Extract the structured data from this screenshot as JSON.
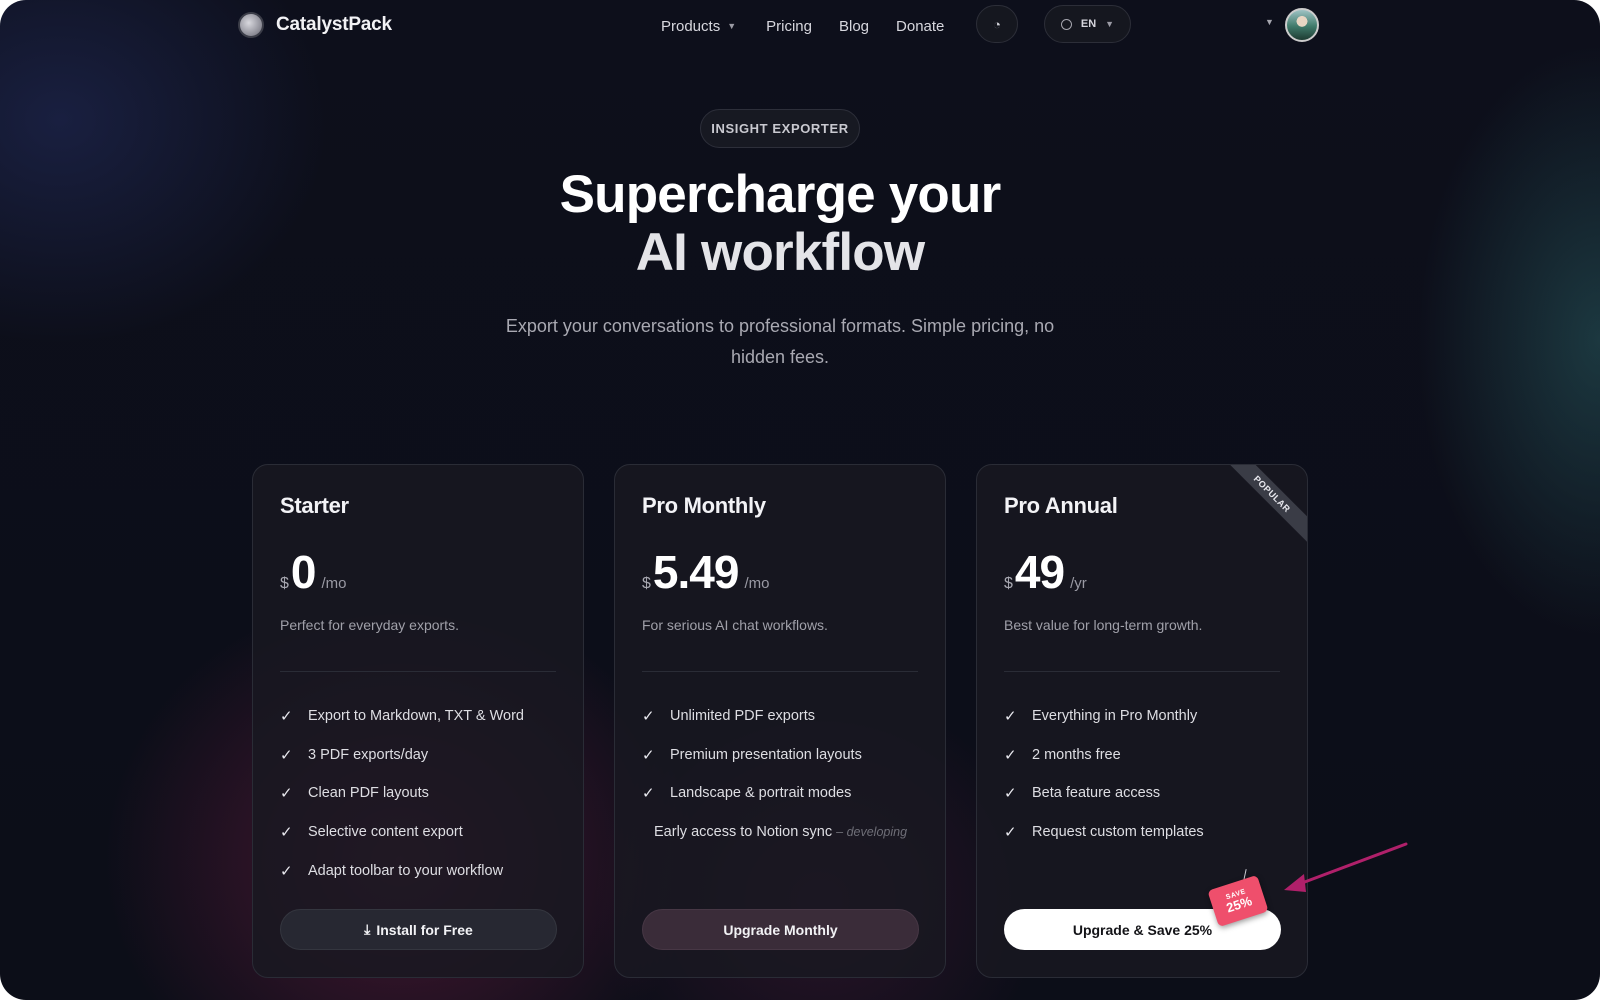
{
  "brand": {
    "name": "CatalystPack"
  },
  "nav": {
    "items": [
      {
        "label": "Products",
        "has_caret": true
      },
      {
        "label": "Pricing"
      },
      {
        "label": "Blog"
      },
      {
        "label": "Donate"
      }
    ],
    "theme_icon": "theme-toggle-icon",
    "language": "EN"
  },
  "hero": {
    "badge": "INSIGHT EXPORTER",
    "headline_line1": "Supercharge your",
    "headline_line2": "AI workflow",
    "subtitle": "Export your conversations to professional formats. Simple pricing, no hidden fees."
  },
  "plans": [
    {
      "name": "Starter",
      "currency": "$",
      "price": "0",
      "period": "/mo",
      "description": "Perfect for everyday exports.",
      "features": [
        "Export to Markdown, TXT & Word",
        "3 PDF exports/day",
        "Clean PDF layouts",
        "Selective content export",
        "Adapt toolbar to your workflow"
      ],
      "button": "Install for Free"
    },
    {
      "name": "Pro Monthly",
      "currency": "$",
      "price": "5.49",
      "period": "/mo",
      "description": "For serious AI chat workflows.",
      "features": [
        "Unlimited PDF exports",
        "Premium presentation layouts",
        "Landscape & portrait modes"
      ],
      "upcoming_feature": "Early access to Notion sync",
      "upcoming_note": "– developing",
      "button": "Upgrade Monthly"
    },
    {
      "name": "Pro Annual",
      "currency": "$",
      "price": "49",
      "period": "/yr",
      "description": "Best value for long-term growth.",
      "ribbon": "POPULAR",
      "features": [
        "Everything in Pro Monthly",
        "2 months free",
        "Beta feature access",
        "Request custom templates"
      ],
      "button": "Upgrade & Save 25%",
      "save_tag_top": "SAVE",
      "save_tag_bottom": "25%"
    }
  ],
  "colors": {
    "background": "#0d0f1b",
    "card": "#181921",
    "save_tag": "#ef4f6c",
    "annotation_arrow": "#b0206a"
  }
}
